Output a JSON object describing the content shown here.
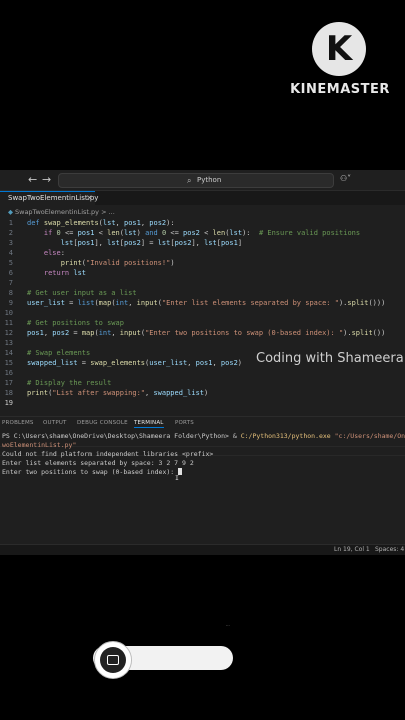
{
  "overlay": {
    "brand_logo_letter": "K",
    "brand_name": "KINEMASTER",
    "channel_watermark": "Coding with Shameera",
    "small_caption": "..."
  },
  "titlebar": {
    "back_icon": "arrow-left-icon",
    "forward_icon": "arrow-right-icon",
    "search_icon": "search-icon",
    "search_text": "Python",
    "copilot_icon": "copilot-icon"
  },
  "tab": {
    "filename": "SwapTwoElementinList.py",
    "close": "×"
  },
  "breadcrumb": {
    "file": "SwapTwoElementinList.py",
    "more": "> ..."
  },
  "editor": {
    "current_line": 19,
    "line_numbers": [
      "1",
      "2",
      "3",
      "4",
      "5",
      "6",
      "7",
      "8",
      "9",
      "10",
      "11",
      "12",
      "13",
      "14",
      "15",
      "16",
      "17",
      "18",
      "19"
    ]
  },
  "panel": {
    "tabs": [
      "PROBLEMS",
      "OUTPUT",
      "DEBUG CONSOLE",
      "TERMINAL",
      "PORTS"
    ],
    "active_tab": "TERMINAL"
  },
  "terminal": {
    "prompt_prefix": "PS C:\\Users\\shame\\OneDrive\\Desktop\\Shameera Folder\\Python> & ",
    "exe_path": "C:/Python313/python.exe",
    "script_arg_1": " \"c:/Users/shame/OneDrive",
    "script_arg_2": "woElementinList.py\"",
    "line2": "Could not find platform independent libraries <prefix>",
    "line3": "Enter list elements separated by space: 3 2 7 9 2",
    "line4": "Enter two positions to swap (0-based index): "
  },
  "statusbar": {
    "position": "Ln 19, Col 1",
    "spaces": "Spaces: 4"
  }
}
